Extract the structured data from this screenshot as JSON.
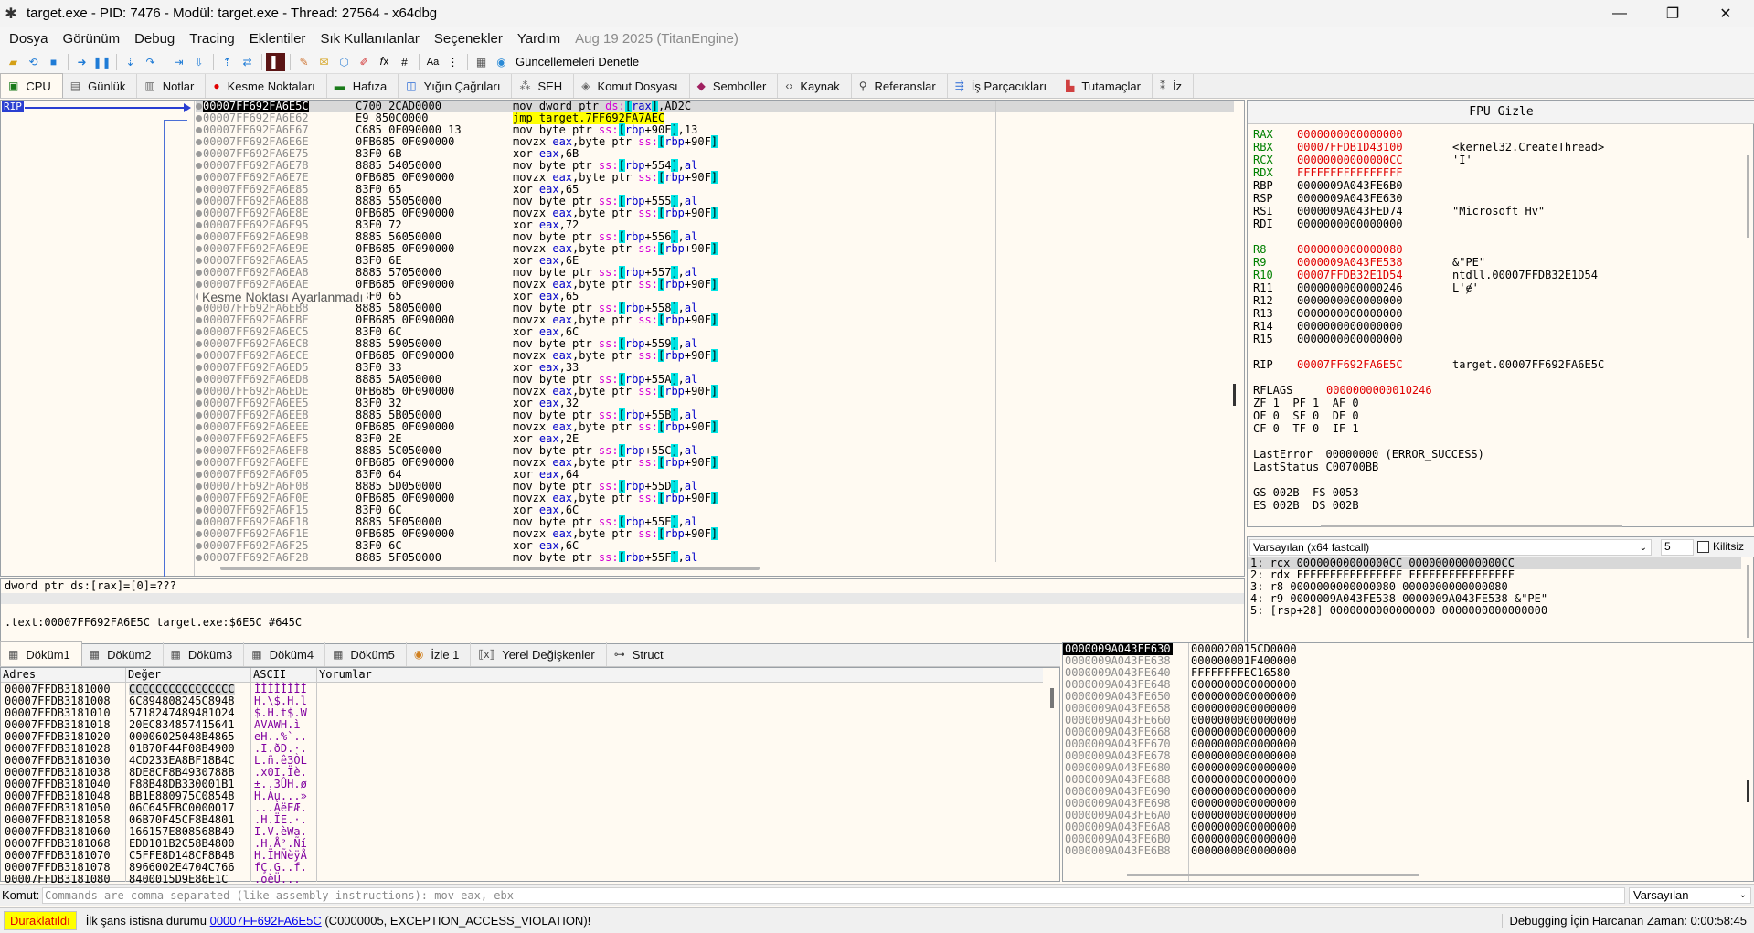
{
  "window": {
    "title": "target.exe - PID: 7476 - Modül: target.exe - Thread: 27564 - x64dbg",
    "minimize": "—",
    "maximize": "❐",
    "close": "✕"
  },
  "menu": {
    "items": [
      "Dosya",
      "Görünüm",
      "Debug",
      "Tracing",
      "Eklentiler",
      "Sık Kullanılanlar",
      "Seçenekler",
      "Yardım"
    ],
    "date": "Aug 19 2025 (TitanEngine)"
  },
  "toolbar": {
    "update_label": "Güncellemeleri Denetle"
  },
  "tabs": [
    {
      "label": "CPU",
      "icon": "cpu-icon"
    },
    {
      "label": "Günlük",
      "icon": "log-icon"
    },
    {
      "label": "Notlar",
      "icon": "notes-icon"
    },
    {
      "label": "Kesme Noktaları",
      "icon": "breakpoint-icon"
    },
    {
      "label": "Hafıza",
      "icon": "memory-icon"
    },
    {
      "label": "Yığın Çağrıları",
      "icon": "callstack-icon"
    },
    {
      "label": "SEH",
      "icon": "seh-icon"
    },
    {
      "label": "Komut Dosyası",
      "icon": "script-icon"
    },
    {
      "label": "Semboller",
      "icon": "symbols-icon"
    },
    {
      "label": "Kaynak",
      "icon": "source-icon"
    },
    {
      "label": "Referanslar",
      "icon": "references-icon"
    },
    {
      "label": "İş Parçacıkları",
      "icon": "threads-icon"
    },
    {
      "label": "Tutamaçlar",
      "icon": "handles-icon"
    },
    {
      "label": "İz",
      "icon": "trace-icon"
    }
  ],
  "cpu": {
    "rip_label": "RIP",
    "tooltip": "Kesme Noktası Ayarlanmadı",
    "rows": [
      {
        "addr": "00007FF692FA6E5C",
        "bytes": "C700 2CAD0000",
        "instr": "mov dword ptr ds:[rax],AD2C"
      },
      {
        "addr": "00007FF692FA6E62",
        "bytes": "E9 850C0000",
        "instr": "jmp target.7FF692FA7AEC"
      },
      {
        "addr": "00007FF692FA6E67",
        "bytes": "C685 0F090000 13",
        "instr": "mov byte ptr ss:[rbp+90F],13"
      },
      {
        "addr": "00007FF692FA6E6E",
        "bytes": "0FB685 0F090000",
        "instr": "movzx eax,byte ptr ss:[rbp+90F]"
      },
      {
        "addr": "00007FF692FA6E75",
        "bytes": "83F0 6B",
        "instr": "xor eax,6B"
      },
      {
        "addr": "00007FF692FA6E78",
        "bytes": "8885 54050000",
        "instr": "mov byte ptr ss:[rbp+554],al"
      },
      {
        "addr": "00007FF692FA6E7E",
        "bytes": "0FB685 0F090000",
        "instr": "movzx eax,byte ptr ss:[rbp+90F]"
      },
      {
        "addr": "00007FF692FA6E85",
        "bytes": "83F0 65",
        "instr": "xor eax,65"
      },
      {
        "addr": "00007FF692FA6E88",
        "bytes": "8885 55050000",
        "instr": "mov byte ptr ss:[rbp+555],al"
      },
      {
        "addr": "00007FF692FA6E8E",
        "bytes": "0FB685 0F090000",
        "instr": "movzx eax,byte ptr ss:[rbp+90F]"
      },
      {
        "addr": "00007FF692FA6E95",
        "bytes": "83F0 72",
        "instr": "xor eax,72"
      },
      {
        "addr": "00007FF692FA6E98",
        "bytes": "8885 56050000",
        "instr": "mov byte ptr ss:[rbp+556],al"
      },
      {
        "addr": "00007FF692FA6E9E",
        "bytes": "0FB685 0F090000",
        "instr": "movzx eax,byte ptr ss:[rbp+90F]"
      },
      {
        "addr": "00007FF692FA6EA5",
        "bytes": "83F0 6E",
        "instr": "xor eax,6E"
      },
      {
        "addr": "00007FF692FA6EA8",
        "bytes": "8885 57050000",
        "instr": "mov byte ptr ss:[rbp+557],al"
      },
      {
        "addr": "00007FF692FA6EAE",
        "bytes": "0FB685 0F090000",
        "instr": "movzx eax,byte ptr ss:[rbp+90F]"
      },
      {
        "addr": "00007FF692FA6EB5",
        "bytes": "83F0 65",
        "instr": "xor eax,65"
      },
      {
        "addr": "00007FF692FA6EB8",
        "bytes": "8885 58050000",
        "instr": "mov byte ptr ss:[rbp+558],al"
      },
      {
        "addr": "00007FF692FA6EBE",
        "bytes": "0FB685 0F090000",
        "instr": "movzx eax,byte ptr ss:[rbp+90F]"
      },
      {
        "addr": "00007FF692FA6EC5",
        "bytes": "83F0 6C",
        "instr": "xor eax,6C"
      },
      {
        "addr": "00007FF692FA6EC8",
        "bytes": "8885 59050000",
        "instr": "mov byte ptr ss:[rbp+559],al"
      },
      {
        "addr": "00007FF692FA6ECE",
        "bytes": "0FB685 0F090000",
        "instr": "movzx eax,byte ptr ss:[rbp+90F]"
      },
      {
        "addr": "00007FF692FA6ED5",
        "bytes": "83F0 33",
        "instr": "xor eax,33"
      },
      {
        "addr": "00007FF692FA6ED8",
        "bytes": "8885 5A050000",
        "instr": "mov byte ptr ss:[rbp+55A],al"
      },
      {
        "addr": "00007FF692FA6EDE",
        "bytes": "0FB685 0F090000",
        "instr": "movzx eax,byte ptr ss:[rbp+90F]"
      },
      {
        "addr": "00007FF692FA6EE5",
        "bytes": "83F0 32",
        "instr": "xor eax,32"
      },
      {
        "addr": "00007FF692FA6EE8",
        "bytes": "8885 5B050000",
        "instr": "mov byte ptr ss:[rbp+55B],al"
      },
      {
        "addr": "00007FF692FA6EEE",
        "bytes": "0FB685 0F090000",
        "instr": "movzx eax,byte ptr ss:[rbp+90F]"
      },
      {
        "addr": "00007FF692FA6EF5",
        "bytes": "83F0 2E",
        "instr": "xor eax,2E"
      },
      {
        "addr": "00007FF692FA6EF8",
        "bytes": "8885 5C050000",
        "instr": "mov byte ptr ss:[rbp+55C],al"
      },
      {
        "addr": "00007FF692FA6EFE",
        "bytes": "0FB685 0F090000",
        "instr": "movzx eax,byte ptr ss:[rbp+90F]"
      },
      {
        "addr": "00007FF692FA6F05",
        "bytes": "83F0 64",
        "instr": "xor eax,64"
      },
      {
        "addr": "00007FF692FA6F08",
        "bytes": "8885 5D050000",
        "instr": "mov byte ptr ss:[rbp+55D],al"
      },
      {
        "addr": "00007FF692FA6F0E",
        "bytes": "0FB685 0F090000",
        "instr": "movzx eax,byte ptr ss:[rbp+90F]"
      },
      {
        "addr": "00007FF692FA6F15",
        "bytes": "83F0 6C",
        "instr": "xor eax,6C"
      },
      {
        "addr": "00007FF692FA6F18",
        "bytes": "8885 5E050000",
        "instr": "mov byte ptr ss:[rbp+55E],al"
      },
      {
        "addr": "00007FF692FA6F1E",
        "bytes": "0FB685 0F090000",
        "instr": "movzx eax,byte ptr ss:[rbp+90F]"
      },
      {
        "addr": "00007FF692FA6F25",
        "bytes": "83F0 6C",
        "instr": "xor eax,6C"
      },
      {
        "addr": "00007FF692FA6F28",
        "bytes": "8885 5F050000",
        "instr": "mov byte ptr ss:[rbp+55F],al"
      }
    ]
  },
  "info": {
    "top": "dword ptr ds:[rax]=[0]=???",
    "bottom": ".text:00007FF692FA6E5C target.exe:$6E5C #645C"
  },
  "registers": {
    "fpu_button": "FPU Gizle",
    "gp": [
      {
        "name": "RAX",
        "value": "0000000000000000",
        "comment": "",
        "changed": true
      },
      {
        "name": "RBX",
        "value": "00007FFDB1D43100",
        "comment": "<kernel32.CreateThread>",
        "changed": true
      },
      {
        "name": "RCX",
        "value": "00000000000000CC",
        "comment": "'Ì'",
        "changed": true
      },
      {
        "name": "RDX",
        "value": "FFFFFFFFFFFFFFFF",
        "comment": "",
        "changed": true
      },
      {
        "name": "RBP",
        "value": "0000009A043FE6B0",
        "comment": "",
        "changed": false
      },
      {
        "name": "RSP",
        "value": "0000009A043FE630",
        "comment": "",
        "changed": false
      },
      {
        "name": "RSI",
        "value": "0000009A043FED74",
        "comment": "\"Microsoft Hv\"",
        "changed": false
      },
      {
        "name": "RDI",
        "value": "0000000000000000",
        "comment": "",
        "changed": false
      }
    ],
    "ext": [
      {
        "name": "R8",
        "value": "0000000000000080",
        "comment": "",
        "changed": true
      },
      {
        "name": "R9",
        "value": "0000009A043FE538",
        "comment": "&\"PE\"",
        "changed": true
      },
      {
        "name": "R10",
        "value": "00007FFDB32E1D54",
        "comment": "ntdll.00007FFDB32E1D54",
        "changed": true
      },
      {
        "name": "R11",
        "value": "0000000000000246",
        "comment": "L'ɇ'",
        "changed": false
      },
      {
        "name": "R12",
        "value": "0000000000000000",
        "comment": "",
        "changed": false
      },
      {
        "name": "R13",
        "value": "0000000000000000",
        "comment": "",
        "changed": false
      },
      {
        "name": "R14",
        "value": "0000000000000000",
        "comment": "",
        "changed": false
      },
      {
        "name": "R15",
        "value": "0000000000000000",
        "comment": "",
        "changed": false
      }
    ],
    "rip": {
      "name": "RIP",
      "value": "00007FF692FA6E5C",
      "comment": "target.00007FF692FA6E5C"
    },
    "rflags": {
      "name": "RFLAGS",
      "value": "0000000000010246"
    },
    "flags_rows": [
      "ZF 1  PF 1  AF 0",
      "OF 0  SF 0  DF 0",
      "CF 0  TF 0  IF 1"
    ],
    "last_error": "LastError  00000000 (ERROR_SUCCESS)",
    "last_status": "LastStatus C00700BB",
    "seg1": "GS 002B  FS 0053",
    "seg2": "ES 002B  DS 002B"
  },
  "callconv": {
    "select": "Varsayılan (x64 fastcall)",
    "count": "5",
    "lock_label": "Kilitsiz",
    "rows": [
      "1: rcx 00000000000000CC 00000000000000CC",
      "2: rdx FFFFFFFFFFFFFFFF FFFFFFFFFFFFFFFF",
      "3: r8 0000000000000080 0000000000000080",
      "4: r9 0000009A043FE538 0000009A043FE538 &\"PE\"",
      "5: [rsp+28] 0000000000000000 0000000000000000"
    ]
  },
  "dump_tabs": [
    {
      "label": "Döküm1",
      "icon": "dump-icon"
    },
    {
      "label": "Döküm2",
      "icon": "dump-icon"
    },
    {
      "label": "Döküm3",
      "icon": "dump-icon"
    },
    {
      "label": "Döküm4",
      "icon": "dump-icon"
    },
    {
      "label": "Döküm5",
      "icon": "dump-icon"
    },
    {
      "label": "İzle 1",
      "icon": "watch-icon"
    },
    {
      "label": "Yerel Değişkenler",
      "icon": "locals-icon"
    },
    {
      "label": "Struct",
      "icon": "struct-icon"
    }
  ],
  "dump": {
    "headers": [
      "Adres",
      "Değer",
      "ASCII",
      "Yorumlar"
    ],
    "rows": [
      {
        "addr": "00007FFDB3181000",
        "val": "CCCCCCCCCCCCCCCC",
        "ascii": "ÌÌÌÌÌÌÌÌ"
      },
      {
        "addr": "00007FFDB3181008",
        "val": "6C894808245C8948",
        "ascii": "H.\\$.H.l"
      },
      {
        "addr": "00007FFDB3181010",
        "val": "5718247489481024",
        "ascii": "$.H.t$.W"
      },
      {
        "addr": "00007FFDB3181018",
        "val": "20EC834857415641",
        "ascii": "AVAWH.ì "
      },
      {
        "addr": "00007FFDB3181020",
        "val": "00006025048B4865",
        "ascii": "eH..%`.."
      },
      {
        "addr": "00007FFDB3181028",
        "val": "01B70F44F08B4900",
        "ascii": ".I.ðD.·."
      },
      {
        "addr": "00007FFDB3181030",
        "val": "4CD233EA8BF18B4C",
        "ascii": "L.ñ.ê3ÒL"
      },
      {
        "addr": "00007FFDB3181038",
        "val": "8DE8CF8B4930788B",
        "ascii": ".x0I.Ïè."
      },
      {
        "addr": "00007FFDB3181040",
        "val": "F88B48DB330001B1",
        "ascii": "±..3ÛH.ø"
      },
      {
        "addr": "00007FFDB3181048",
        "val": "BB1E880975C08548",
        "ascii": "H.Àu...»"
      },
      {
        "addr": "00007FFDB3181050",
        "val": "06C645EBC0000017",
        "ascii": "...ÀëEÆ."
      },
      {
        "addr": "00007FFDB3181058",
        "val": "06B70F45CF8B4801",
        "ascii": ".H.ÏE.·."
      },
      {
        "addr": "00007FFDB3181060",
        "val": "166157E808568B49",
        "ascii": "I.V.èWa."
      },
      {
        "addr": "00007FFDB3181068",
        "val": "EDD101B2C58B4800",
        "ascii": ".H.Å².Ñí"
      },
      {
        "addr": "00007FFDB3181070",
        "val": "C5FFE8D148CF8B48",
        "ascii": "H.ÏHÑèÿÅ"
      },
      {
        "addr": "00007FFDB3181078",
        "val": "8966002E4704C766",
        "ascii": "fÇ.G..f."
      },
      {
        "addr": "00007FFDB3181080",
        "val": "8400015D9E86E1C",
        "ascii": ".oèÜ..."
      }
    ]
  },
  "stack": {
    "rows": [
      {
        "addr": "0000009A043FE630",
        "val": "0000020015CD0000"
      },
      {
        "addr": "0000009A043FE638",
        "val": "000000001F400000"
      },
      {
        "addr": "0000009A043FE640",
        "val": "FFFFFFFFEC16580"
      },
      {
        "addr": "0000009A043FE648",
        "val": "0000000000000000"
      },
      {
        "addr": "0000009A043FE650",
        "val": "0000000000000000"
      },
      {
        "addr": "0000009A043FE658",
        "val": "0000000000000000"
      },
      {
        "addr": "0000009A043FE660",
        "val": "0000000000000000"
      },
      {
        "addr": "0000009A043FE668",
        "val": "0000000000000000"
      },
      {
        "addr": "0000009A043FE670",
        "val": "0000000000000000"
      },
      {
        "addr": "0000009A043FE678",
        "val": "0000000000000000"
      },
      {
        "addr": "0000009A043FE680",
        "val": "0000000000000000"
      },
      {
        "addr": "0000009A043FE688",
        "val": "0000000000000000"
      },
      {
        "addr": "0000009A043FE690",
        "val": "0000000000000000"
      },
      {
        "addr": "0000009A043FE698",
        "val": "0000000000000000"
      },
      {
        "addr": "0000009A043FE6A0",
        "val": "0000000000000000"
      },
      {
        "addr": "0000009A043FE6A8",
        "val": "0000000000000000"
      },
      {
        "addr": "0000009A043FE6B0",
        "val": "0000000000000000"
      },
      {
        "addr": "0000009A043FE6B8",
        "val": "0000000000000000"
      }
    ]
  },
  "command": {
    "label": "Komut:",
    "placeholder": "Commands are comma separated (like assembly instructions): mov eax, ebx",
    "select": "Varsayılan"
  },
  "status": {
    "state": "Duraklatıldı",
    "msg_prefix": "İlk şans istisna durumu ",
    "msg_link": "00007FF692FA6E5C",
    "msg_suffix": " (C0000005, EXCEPTION_ACCESS_VIOLATION)!",
    "timer": "Debugging İçin Harcanan Zaman: 0:00:58:45"
  },
  "colors": {
    "accent": "#2a3fd1",
    "changed_register": "#e00000",
    "bracket_highlight": "#00e5e5",
    "jump_highlight": "#ffff00",
    "paused_bg": "#ffff00"
  }
}
